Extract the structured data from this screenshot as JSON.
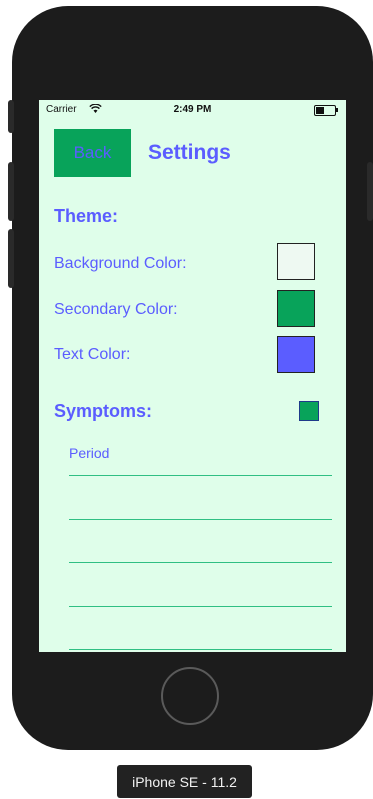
{
  "status_bar": {
    "carrier": "Carrier",
    "time": "2:49 PM"
  },
  "header": {
    "back_label": "Back",
    "title": "Settings"
  },
  "theme": {
    "heading": "Theme:",
    "rows": [
      {
        "label": "Background Color:",
        "color": "#eef9f2"
      },
      {
        "label": "Secondary Color:",
        "color": "#08a35a"
      },
      {
        "label": "Text Color:",
        "color": "#5b5dff"
      }
    ]
  },
  "symptoms": {
    "heading": "Symptoms:",
    "checkbox_checked": true,
    "items": [
      "Period",
      "",
      "",
      "",
      ""
    ]
  },
  "device": {
    "label": "iPhone SE - 11.2"
  },
  "colors": {
    "accent": "#5b5dff",
    "secondary": "#08a35a",
    "background": "#dffeea"
  }
}
